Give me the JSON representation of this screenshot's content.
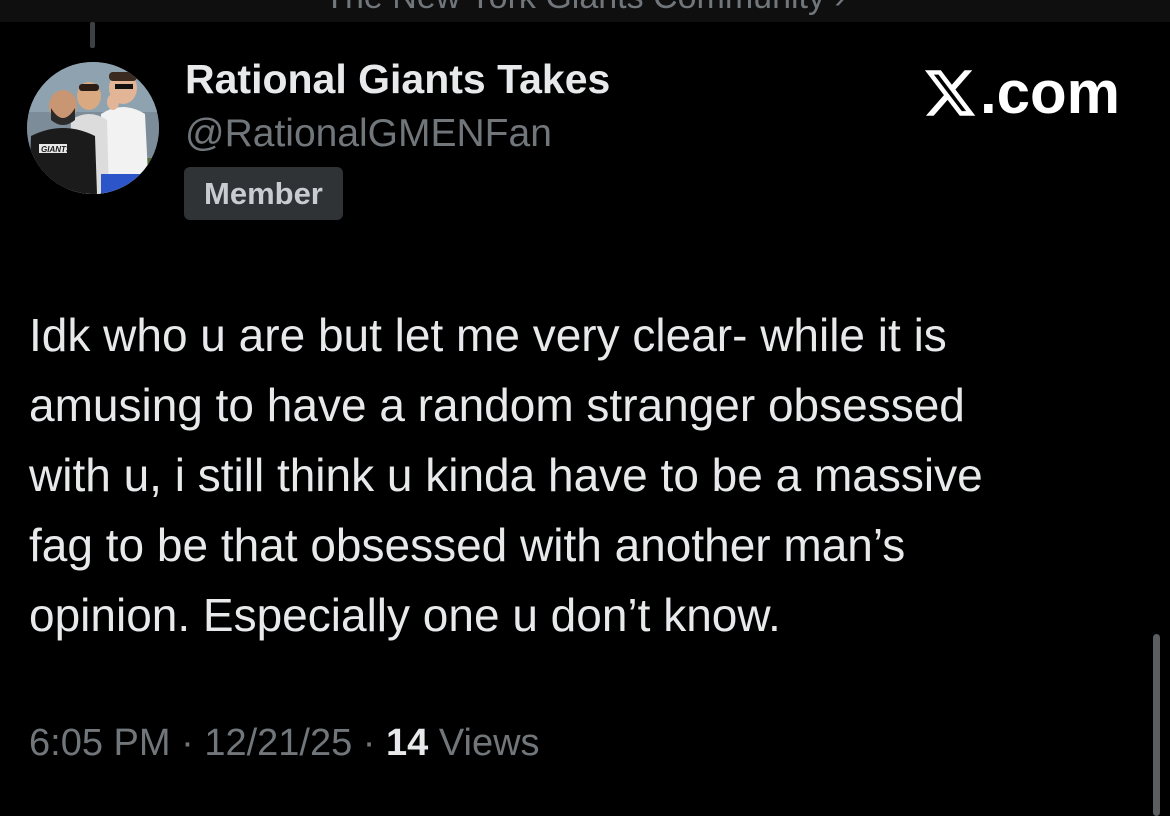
{
  "header": {
    "community_label": "The New York Giants Community ›"
  },
  "author": {
    "display_name": "Rational Giants Takes",
    "handle": "@RationalGMENFan",
    "badge": "Member",
    "avatar_text": "GIANTS"
  },
  "watermark": {
    "text": ".com",
    "icon": "x-logo-icon"
  },
  "tweet": {
    "lines": [
      "Idk who u are but let me very clear- while it is",
      "amusing to have a random stranger obsessed",
      "with u, i still think u kinda have to be a massive",
      "fag to be that obsessed with another man’s",
      "opinion. Especially one u don’t know."
    ]
  },
  "meta": {
    "time": "6:05 PM",
    "separator": " · ",
    "date": "12/21/25",
    "views_count": "14",
    "views_label": " Views"
  },
  "colors": {
    "background": "#000000",
    "text_primary": "#e7e9ea",
    "text_secondary": "#71767b",
    "badge_bg": "#2f3336"
  }
}
